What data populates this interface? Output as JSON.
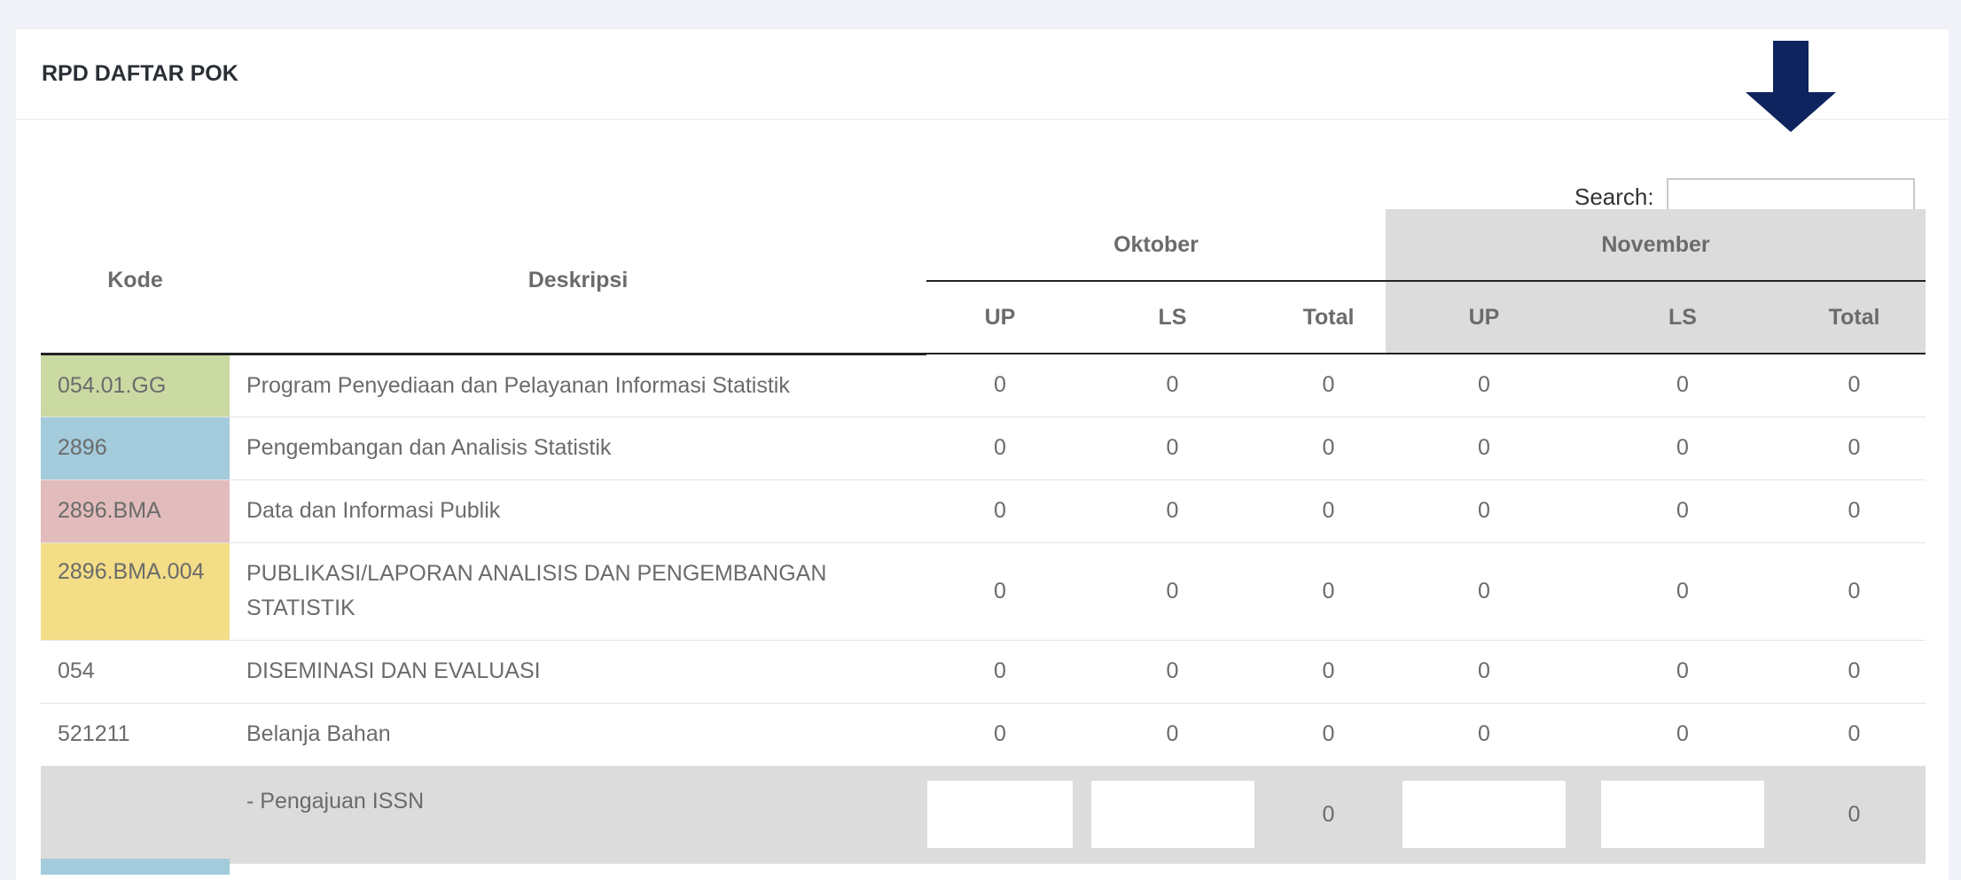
{
  "card": {
    "title": "RPD DAFTAR POK"
  },
  "search": {
    "label": "Search:",
    "placeholder": ""
  },
  "table": {
    "columns": {
      "kode": "Kode",
      "deskripsi": "Deskripsi",
      "months": [
        "Oktober",
        "November"
      ],
      "sub": [
        "UP",
        "LS",
        "Total"
      ]
    },
    "rows": [
      {
        "kode": "054.01.GG",
        "kode_color": "#cbd9a3",
        "desc": "Program Penyediaan dan Pelayanan Informasi Statistik",
        "vals": [
          "0",
          "0",
          "0",
          "0",
          "0",
          "0"
        ]
      },
      {
        "kode": "2896",
        "kode_color": "#a3cbdb",
        "desc": "Pengembangan dan Analisis Statistik",
        "vals": [
          "0",
          "0",
          "0",
          "0",
          "0",
          "0"
        ]
      },
      {
        "kode": "2896.BMA",
        "kode_color": "#e2bcbc",
        "desc": "Data dan Informasi Publik",
        "vals": [
          "0",
          "0",
          "0",
          "0",
          "0",
          "0"
        ]
      },
      {
        "kode": "2896.BMA.004",
        "kode_color": "#f3dd86",
        "desc": "PUBLIKASI/LAPORAN ANALISIS DAN PENGEMBANGAN STATISTIK",
        "vals": [
          "0",
          "0",
          "0",
          "0",
          "0",
          "0"
        ]
      },
      {
        "kode": "054",
        "kode_color": "#ffffff",
        "desc": "DISEMINASI DAN EVALUASI",
        "vals": [
          "0",
          "0",
          "0",
          "0",
          "0",
          "0"
        ]
      },
      {
        "kode": "521211",
        "kode_color": "#ffffff",
        "desc": "Belanja Bahan",
        "vals": [
          "0",
          "0",
          "0",
          "0",
          "0",
          "0"
        ]
      }
    ],
    "input_row": {
      "kode": "",
      "desc": "- Pengajuan ISSN",
      "oct_total": "0",
      "nov_total": "0"
    }
  }
}
